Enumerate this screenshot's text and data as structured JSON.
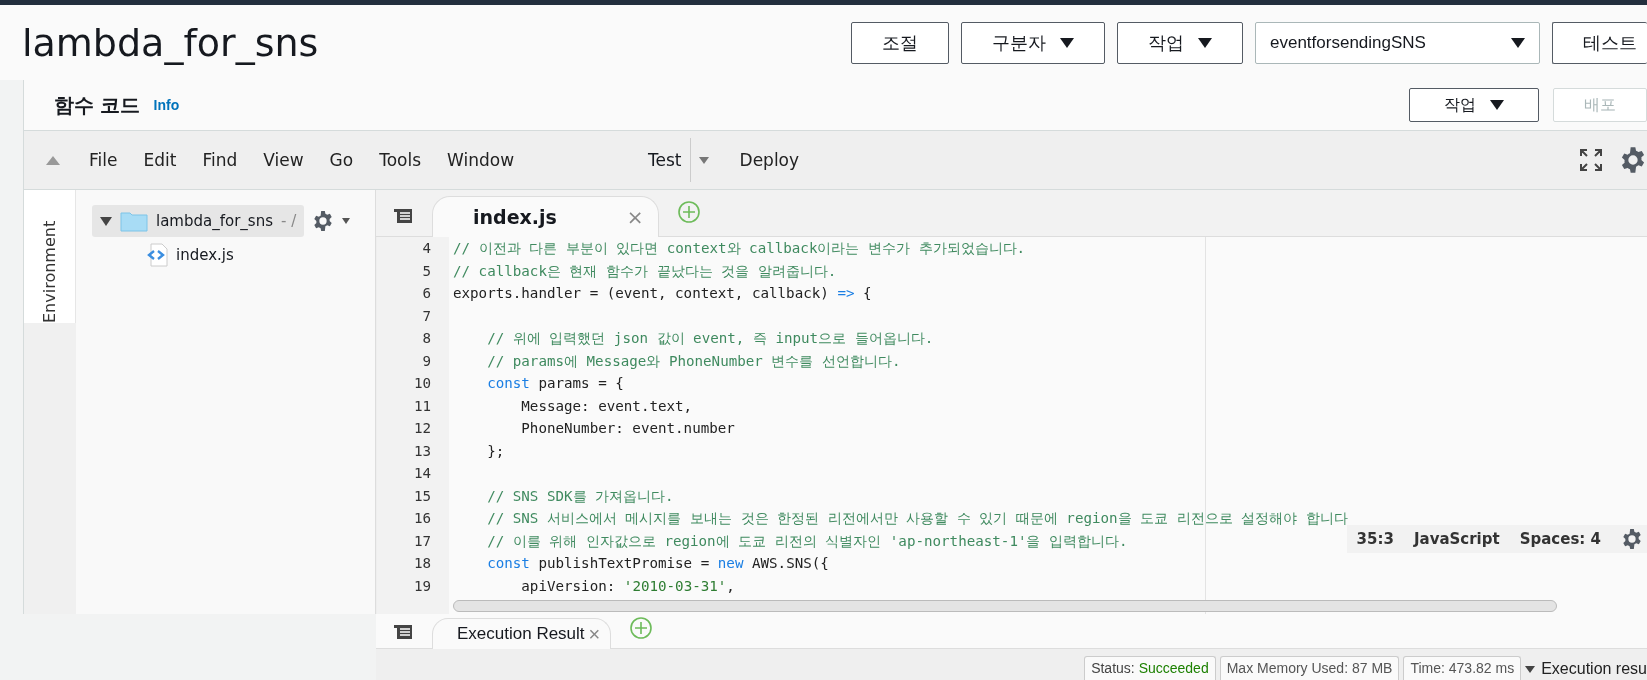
{
  "header": {
    "title": "lambda_for_sns",
    "buttons": [
      {
        "label": "조절",
        "kind": "plain"
      },
      {
        "label": "구분자",
        "kind": "dropdown"
      },
      {
        "label": "작업",
        "kind": "dropdown"
      },
      {
        "label": "eventforsendingSNS",
        "kind": "select"
      },
      {
        "label": "테스트",
        "kind": "plain"
      }
    ]
  },
  "section": {
    "title": "함수 코드",
    "info": "Info",
    "buttons": [
      {
        "label": "작업",
        "kind": "dropdown",
        "disabled": false
      },
      {
        "label": "배포",
        "kind": "plain",
        "disabled": true
      }
    ]
  },
  "toolbar": {
    "menus": [
      "File",
      "Edit",
      "Find",
      "View",
      "Go",
      "Tools",
      "Window"
    ],
    "test": "Test",
    "deploy": "Deploy"
  },
  "side_tab": "Environment",
  "tree": [
    {
      "name": "lambda_for_sns",
      "suffix": "- /",
      "kind": "folder",
      "expanded": true,
      "selected": true,
      "children": [
        {
          "name": "index.js",
          "kind": "file",
          "selected": false
        }
      ]
    }
  ],
  "editor_tab": {
    "label": "index.js",
    "close": "×"
  },
  "code": [
    {
      "n": "4",
      "tokens": [
        {
          "t": "// 이전과 다른 부분이 있다면 context와 callback이라는 변수가 추가되었습니다.",
          "kind": "comment"
        }
      ]
    },
    {
      "n": "5",
      "tokens": [
        {
          "t": "// callback은 현재 함수가 끝났다는 것을 알려줍니다.",
          "kind": "comment"
        }
      ]
    },
    {
      "n": "6",
      "tokens": [
        {
          "t": "exports.handler = (event, context, callback) ",
          "kind": "plain"
        },
        {
          "t": "=>",
          "kind": "keyword"
        },
        {
          "t": " {",
          "kind": "plain"
        }
      ]
    },
    {
      "n": "7"
    },
    {
      "n": "8",
      "tokens": [
        {
          "t": "    // 위에 입력했던 json 값이 event, 즉 input으로 들어옵니다.",
          "kind": "comment"
        }
      ]
    },
    {
      "n": "9",
      "tokens": [
        {
          "t": "    // params에 Message와 PhoneNumber 변수를 선언합니다.",
          "kind": "comment"
        }
      ]
    },
    {
      "n": "10",
      "tokens": [
        {
          "t": "    const",
          "kind": "keyword"
        },
        {
          "t": " params = {",
          "kind": "plain"
        }
      ]
    },
    {
      "n": "11",
      "tokens": [
        {
          "t": "        Message: event.text,",
          "kind": "plain"
        }
      ]
    },
    {
      "n": "12",
      "tokens": [
        {
          "t": "        PhoneNumber: event.number",
          "kind": "plain"
        }
      ]
    },
    {
      "n": "13",
      "tokens": [
        {
          "t": "    };",
          "kind": "plain"
        }
      ]
    },
    {
      "n": "14"
    },
    {
      "n": "15",
      "tokens": [
        {
          "t": "    // SNS SDK를 가져옵니다.",
          "kind": "comment"
        }
      ]
    },
    {
      "n": "16",
      "tokens": [
        {
          "t": "    // SNS 서비스에서 메시지를 보내는 것은 한정된 리전에서만 사용할 수 있기 때문에 region을 도쿄 리전으로 설정해야 합니다",
          "kind": "comment"
        }
      ]
    },
    {
      "n": "17",
      "tokens": [
        {
          "t": "    // 이를 위해 인자값으로 region에 도쿄 리전의 식별자인 'ap-northeast-1'을 입력합니다.",
          "kind": "comment"
        }
      ]
    },
    {
      "n": "18",
      "tokens": [
        {
          "t": "    const",
          "kind": "keyword"
        },
        {
          "t": " publishTextPromise = ",
          "kind": "plain"
        },
        {
          "t": "new",
          "kind": "keyword"
        },
        {
          "t": " AWS.SNS({",
          "kind": "plain"
        }
      ]
    },
    {
      "n": "19",
      "tokens": [
        {
          "t": "        apiVersion: ",
          "kind": "plain"
        },
        {
          "t": "'2010-03-31'",
          "kind": "string"
        },
        {
          "t": ",",
          "kind": "plain"
        }
      ]
    }
  ],
  "editor_status": {
    "position": "35:3",
    "language": "JavaScript",
    "spaces": "Spaces: 4"
  },
  "result_tab": {
    "label": "Execution Result",
    "close": "×"
  },
  "result_status": [
    {
      "label": "Status:",
      "value": "Succeeded",
      "kind": "status"
    },
    {
      "label": "Max Memory Used: 87 MB",
      "kind": "plain"
    },
    {
      "label": "Time: 473.82 ms",
      "kind": "plain"
    },
    {
      "label": "Execution resu",
      "kind": "toggle"
    }
  ]
}
